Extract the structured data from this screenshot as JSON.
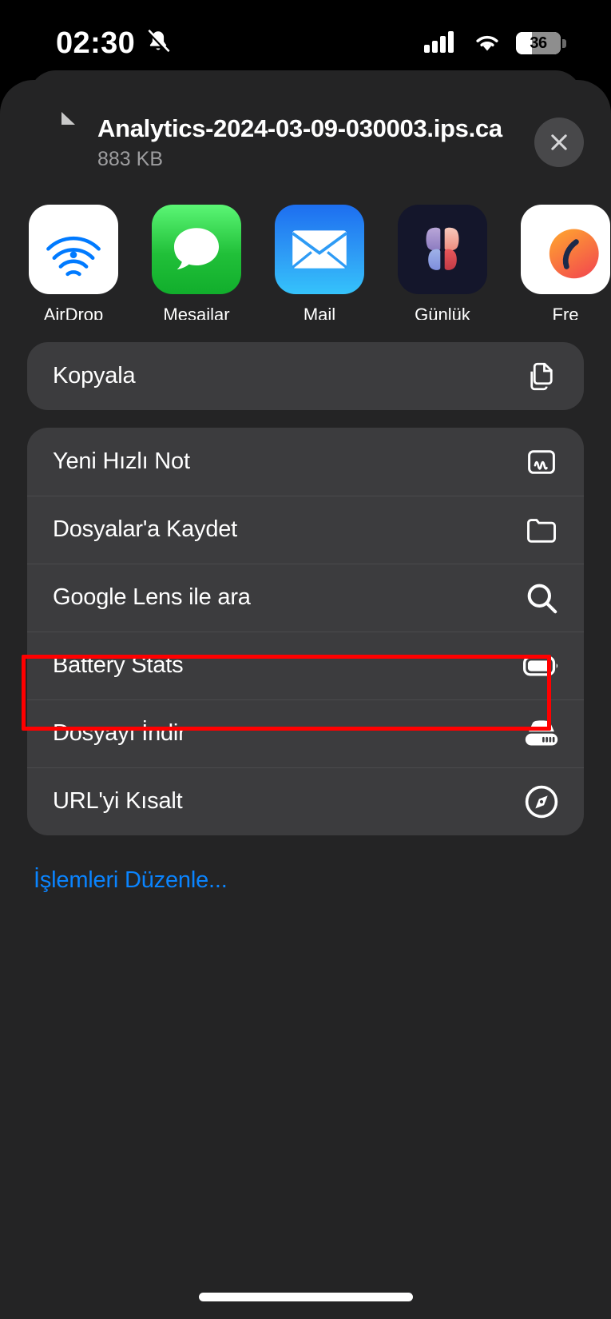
{
  "status_bar": {
    "time": "02:30",
    "mute_icon": "bell-slash-icon",
    "cellular_icon": "cellular-bars-icon",
    "wifi_icon": "wifi-icon",
    "battery_percent": "36",
    "battery_icon": "battery-icon"
  },
  "share_sheet": {
    "file": {
      "name": "Analytics-2024-03-09-030003.ips.ca",
      "size": "883 KB",
      "doc_icon": "document-icon"
    },
    "close_icon": "close-icon",
    "apps": [
      {
        "label": "AirDrop",
        "icon": "airdrop-icon"
      },
      {
        "label": "Mesajlar",
        "icon": "messages-icon"
      },
      {
        "label": "Mail",
        "icon": "mail-icon"
      },
      {
        "label": "Günlük",
        "icon": "journal-icon"
      },
      {
        "label": "Fre",
        "icon": "freeform-icon"
      }
    ],
    "copy_group": [
      {
        "label": "Kopyala",
        "icon": "copy-icon"
      }
    ],
    "actions": [
      {
        "label": "Yeni Hızlı Not",
        "icon": "quick-note-icon"
      },
      {
        "label": "Dosyalar'a Kaydet",
        "icon": "folder-icon"
      },
      {
        "label": "Google Lens ile ara",
        "icon": "search-icon"
      },
      {
        "label": "Battery Stats",
        "icon": "battery-icon"
      },
      {
        "label": "Dosyayı İndir",
        "icon": "download-drive-icon"
      },
      {
        "label": "URL'yi Kısalt",
        "icon": "compass-icon"
      }
    ],
    "edit_actions_label": "İşlemleri Düzenle...",
    "highlight": {
      "target_label": "Battery Stats",
      "color": "#FF0000"
    }
  },
  "colors": {
    "sheet_background": "#242425",
    "row_background": "#3C3C3E",
    "accent_blue": "#0A84FF",
    "annotation_red": "#FF0000"
  }
}
